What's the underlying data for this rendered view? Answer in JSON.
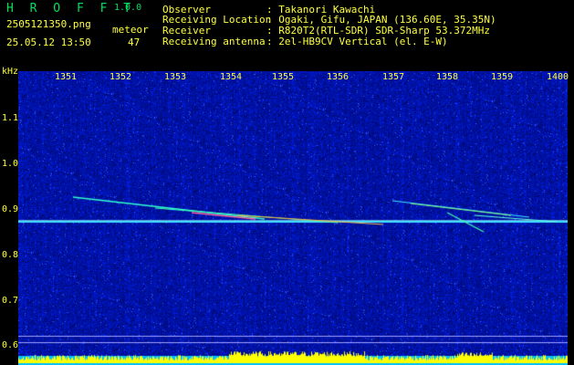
{
  "app": {
    "brand": "H R O F F T",
    "version": "1.0.0",
    "filename": "2505121350.png",
    "datetime": "25.05.12 13:50",
    "meteor_label": "meteor",
    "meteor_count": "47"
  },
  "station": {
    "observer_label": "Observer",
    "observer_value": ": Takanori Kawachi",
    "location_label": "Receiving Location",
    "location_value": ": Ogaki, Gifu, JAPAN (136.60E, 35.35N)",
    "receiver_label": "Receiver",
    "receiver_value": ": R820T2(RTL-SDR) SDR-Sharp 53.372MHz",
    "antenna_label": "Receiving antenna",
    "antenna_value": ": 2el-HB9CV Vertical (el. E-W)"
  },
  "axis": {
    "y_unit": "kHz",
    "y_ticks": [
      "1.1",
      "1.0",
      "0.9",
      "0.8",
      "0.7",
      "0.6"
    ],
    "x_ticks": [
      "1351",
      "1352",
      "1353",
      "1354",
      "1355",
      "1356",
      "1357",
      "1358",
      "1359",
      "1400"
    ]
  },
  "colors": {
    "background": "#000000",
    "header_text": "#ffff40",
    "brand_text": "#00e060",
    "spectrogram_base": "#000a8c",
    "carrier": "#40e0ff",
    "power_meter_fill": "#ffff00",
    "power_meter_base": "#00c0ff"
  }
}
